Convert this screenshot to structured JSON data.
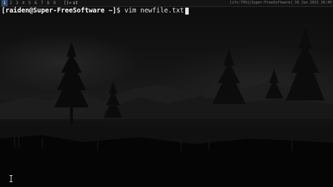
{
  "topbar": {
    "workspaces": [
      "1",
      "2",
      "3",
      "4",
      "5",
      "6",
      "7",
      "8",
      "9"
    ],
    "active_workspace_index": 0,
    "layout_indicator": "[]=",
    "window_tab": "st",
    "status_right": "[ifs:79%]|Super-FreeSoftware| 16 Jun 2021 16:40"
  },
  "terminal": {
    "user_host": "[raiden@Super-FreeSoftware",
    "cwd": " ~]",
    "prompt_symbol": "$ ",
    "command": "vim newfile.txt"
  },
  "colors": {
    "background": "#0d0d0d",
    "active_workspace": "#2f4b6e",
    "text": "#e6e6e6"
  },
  "icons": {
    "mouse_pointer": "ibeam-cursor-icon"
  }
}
